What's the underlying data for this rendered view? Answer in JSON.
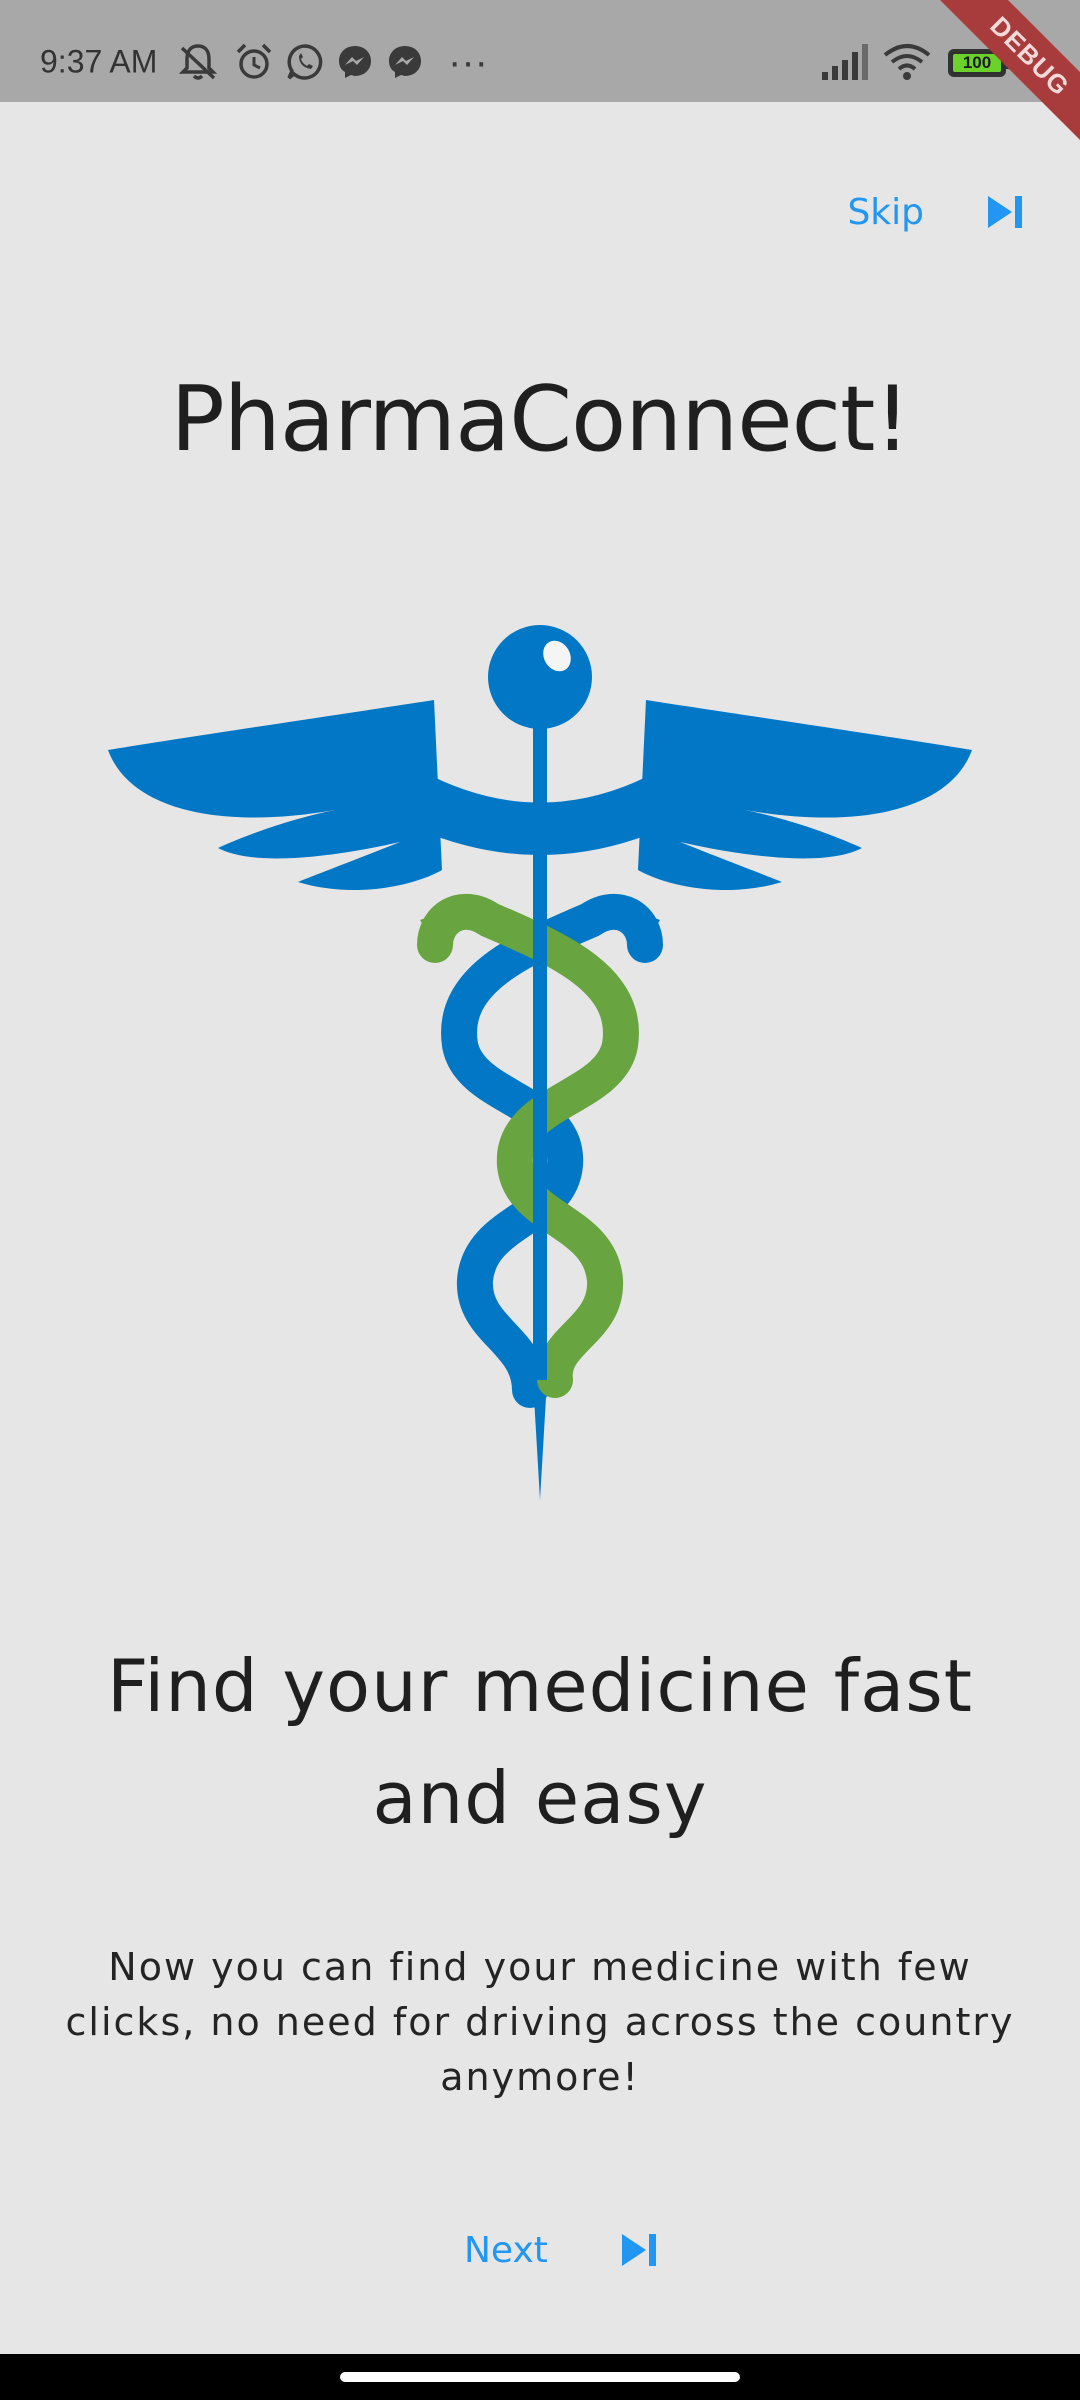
{
  "status_bar": {
    "time": "9:37 AM",
    "battery_text": "100",
    "battery_level": 1.0,
    "icons": [
      "mute-icon",
      "alarm-icon",
      "whatsapp-icon",
      "messenger-icon",
      "messenger-icon",
      "overflow-dots-icon",
      "signal-icon",
      "wifi-icon",
      "battery-icon",
      "charging-icon"
    ],
    "overflow": "···"
  },
  "debug_banner": "DEBUG",
  "onboarding": {
    "skip_label": "Skip",
    "app_title": "PharmaConnect!",
    "headline": "Find your medicine fast and easy",
    "description": "Now you can find your medicine with few clicks, no need for driving across the country anymore!",
    "next_label": "Next",
    "logo": "caduceus-logo"
  },
  "colors": {
    "background": "#e6e6e7",
    "accent": "#2196f3",
    "logo_blue": "#0277c6",
    "logo_green": "#68a43f",
    "text": "#1f1f1f"
  }
}
